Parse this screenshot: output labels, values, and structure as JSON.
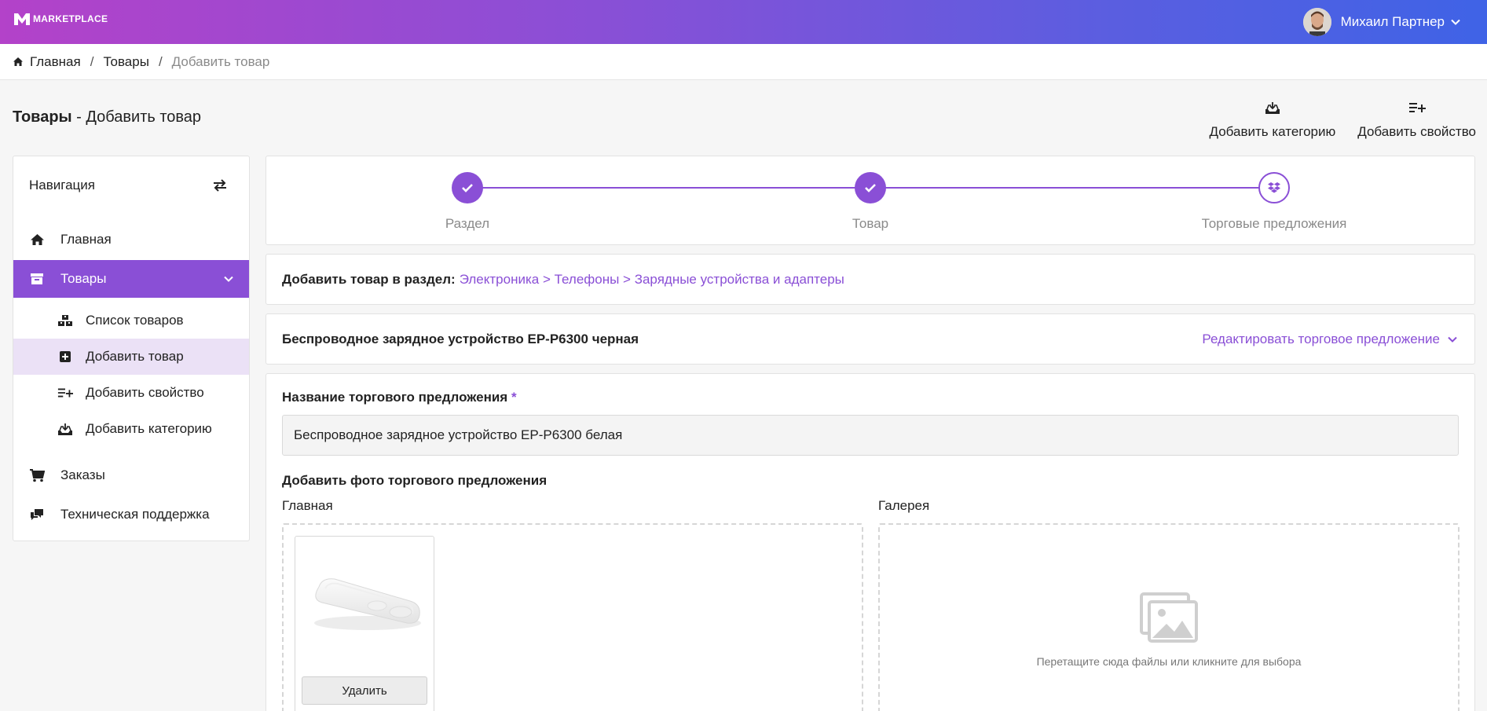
{
  "header": {
    "logo_text": "MARKETPLACE",
    "user_name": "Михаил Партнер"
  },
  "breadcrumb": {
    "home": "Главная",
    "products": "Товары",
    "current": "Добавить товар",
    "separator": "/"
  },
  "page": {
    "title_bold": "Товары",
    "title_rest": " - Добавить товар",
    "actions": [
      {
        "label": "Добавить категорию",
        "icon": "add-category-icon"
      },
      {
        "label": "Добавить свойство",
        "icon": "add-property-icon"
      }
    ]
  },
  "sidebar": {
    "heading": "Навигация",
    "items": [
      {
        "label": "Главная",
        "icon": "home-icon"
      },
      {
        "label": "Товары",
        "icon": "archive-icon"
      },
      {
        "label": "Список товаров",
        "icon": "boxes-icon"
      },
      {
        "label": "Добавить товар",
        "icon": "plus-square-icon"
      },
      {
        "label": "Добавить свойство",
        "icon": "add-property-icon"
      },
      {
        "label": "Добавить категорию",
        "icon": "add-category-icon"
      },
      {
        "label": "Заказы",
        "icon": "cart-icon"
      },
      {
        "label": "Техническая поддержка",
        "icon": "chat-icon"
      }
    ]
  },
  "stepper": {
    "steps": [
      {
        "label": "Раздел",
        "state": "done"
      },
      {
        "label": "Товар",
        "state": "done"
      },
      {
        "label": "Торговые предложения",
        "state": "current"
      }
    ]
  },
  "section": {
    "label": "Добавить товар в раздел:",
    "path": "Электроника > Телефоны > Зарядные устройства и адаптеры"
  },
  "offer": {
    "title": "Беспроводное зарядное устройство EP-P6300 черная",
    "edit_label": "Редактировать торговое предложение"
  },
  "form": {
    "name_label": "Название торгового предложения",
    "required_mark": "*",
    "name_value": "Беспроводное зарядное устройство EP-P6300 белая",
    "photo_label": "Добавить фото торгового предложения",
    "main_label": "Главная",
    "gallery_label": "Галерея",
    "delete_label": "Удалить",
    "gallery_hint": "Перетащите сюда файлы или кликните для выбора"
  },
  "colors": {
    "accent": "#8a4fd6",
    "gradient_start": "#b342c9",
    "gradient_end": "#3f63e6"
  }
}
